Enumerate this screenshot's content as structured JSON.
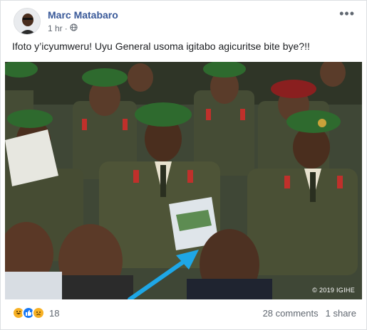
{
  "post": {
    "author": "Marc Matabaro",
    "time": "1 hr",
    "dot": "·",
    "text": "Ifoto y’icyumweru! Uyu General usoma igitabo agicuritse bite bye?!!",
    "photo_credit": "© 2019 IGIHE",
    "more_label": "•••"
  },
  "footer": {
    "reaction_count": "18",
    "comments": "28 comments",
    "shares": "1 share"
  },
  "icons": {
    "globe": "globe-icon",
    "haha": "haha-reaction-icon",
    "like": "like-reaction-icon",
    "sad": "sad-reaction-icon",
    "arrow": "arrow-annotation"
  },
  "colors": {
    "author_link": "#385898",
    "meta": "#606770",
    "like_blue": "#1877f2",
    "haha_yellow": "#f7b125",
    "arrow_blue": "#1ea7e6",
    "beret_green": "#2e6a2e",
    "uniform_olive": "#4e5437"
  }
}
